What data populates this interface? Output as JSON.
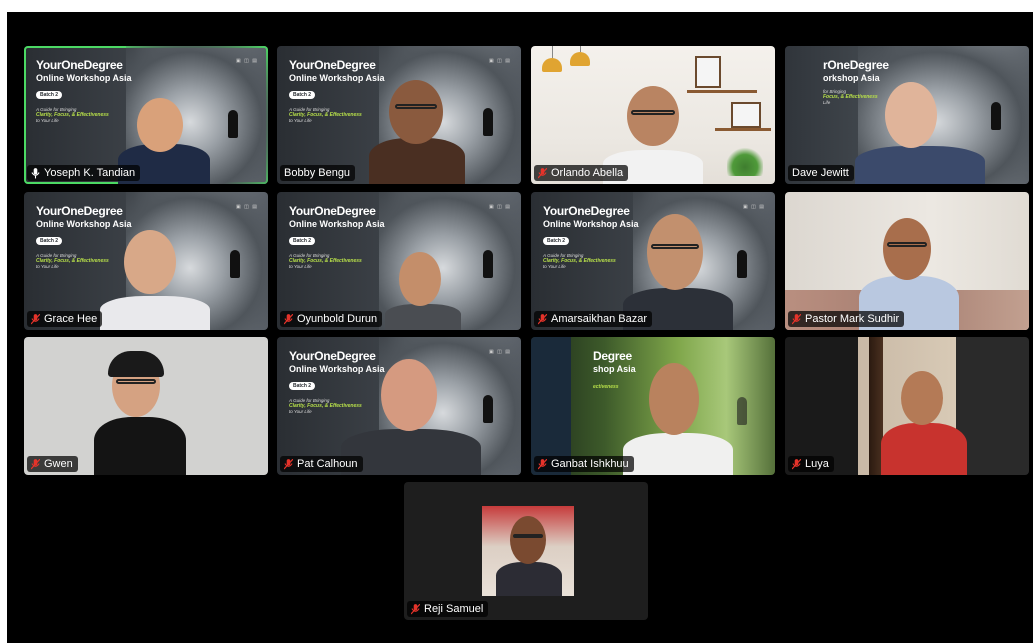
{
  "workshop_slide": {
    "brand": "YourOneDegree",
    "subtitle": "Online Workshop Asia",
    "batch": "Batch 2",
    "tagline_1": "A Guide for Bringing",
    "tagline_2": "Clarity, Focus, & Effectiveness",
    "tagline_3": "to Your Life",
    "partial_brand": "rOneDegree",
    "partial_subtitle": "orkshop Asia",
    "partial_brand_2": "Degree",
    "partial_subtitle_2": "shop Asia",
    "partial_tagline_1": "for Bringing",
    "partial_tagline_2": "Focus, & Effectiveness",
    "partial_tagline_3": "Life",
    "partial_tagline_4": "ectiveness",
    "logos": "▣ ◫ ▤"
  },
  "participants": [
    {
      "name": "Yoseph K. Tandian",
      "audio": "host-speaking",
      "active_speaker": true
    },
    {
      "name": "Bobby Bengu",
      "audio": "none"
    },
    {
      "name": "Orlando Abella",
      "audio": "muted"
    },
    {
      "name": "Dave Jewitt",
      "audio": "none"
    },
    {
      "name": "Grace Hee",
      "audio": "muted"
    },
    {
      "name": "Oyunbold Durun",
      "audio": "muted"
    },
    {
      "name": "Amarsaikhan Bazar",
      "audio": "muted"
    },
    {
      "name": "Pastor Mark Sudhir",
      "audio": "muted"
    },
    {
      "name": "Gwen",
      "audio": "muted"
    },
    {
      "name": "Pat Calhoun",
      "audio": "muted"
    },
    {
      "name": "Ganbat Ishkhuu",
      "audio": "muted"
    },
    {
      "name": "Luya",
      "audio": "muted"
    },
    {
      "name": "Reji Samuel",
      "audio": "muted"
    }
  ],
  "colors": {
    "active_border": "#4cd964",
    "muted_mic": "#e5332a",
    "slide_accent": "#b8e04a"
  }
}
